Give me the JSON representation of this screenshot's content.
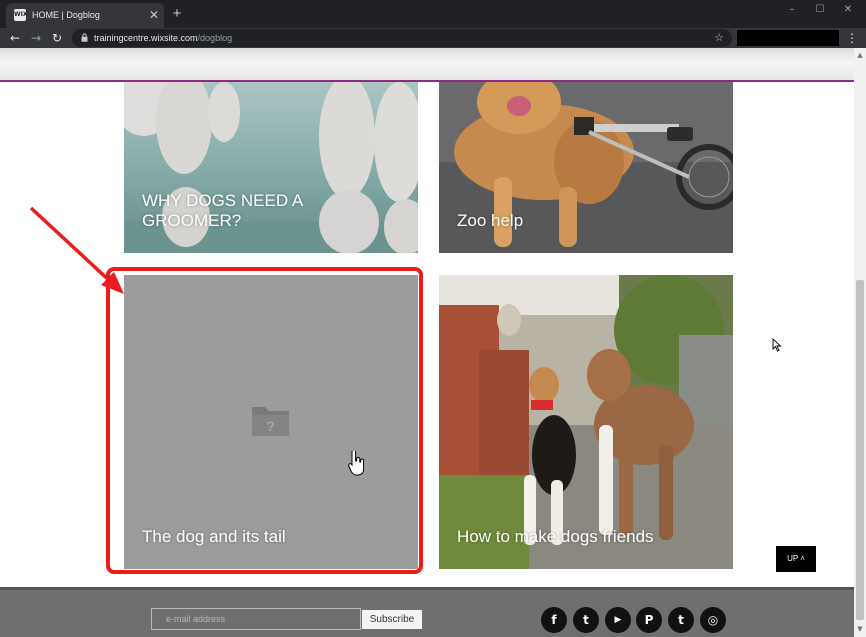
{
  "browser": {
    "tab_favicon": "WIX",
    "tab_title": "HOME | Dogblog",
    "close_glyph": "✕",
    "new_tab_glyph": "+",
    "url_host": "trainingcentre.wixsite.com",
    "url_path": "/dogblog",
    "icons": [
      "back-icon",
      "forward-icon",
      "reload-icon",
      "lock-icon",
      "star-icon",
      "menu-icon"
    ]
  },
  "posts": [
    {
      "title": "WHY DOGS NEED A GROOMER?"
    },
    {
      "title": "Zoo help"
    },
    {
      "title": "The dog and its tail"
    },
    {
      "title": "How to make dogs friends"
    }
  ],
  "up_button": {
    "label": "UP",
    "glyph": "˄"
  },
  "footer": {
    "email_placeholder": "e-mail address",
    "subscribe_label": "Subscribe",
    "social": [
      {
        "name": "facebook-icon",
        "glyph": "f"
      },
      {
        "name": "twitter-icon",
        "glyph": "t"
      },
      {
        "name": "youtube-icon",
        "glyph": "▶"
      },
      {
        "name": "pinterest-icon",
        "glyph": "P"
      },
      {
        "name": "tumblr-icon",
        "glyph": "t"
      },
      {
        "name": "instagram-icon",
        "glyph": "◎"
      }
    ]
  },
  "colors": {
    "highlight": "#ea1c1c",
    "header_border": "#8e2c83",
    "footer_bg": "#6f6f6f"
  }
}
